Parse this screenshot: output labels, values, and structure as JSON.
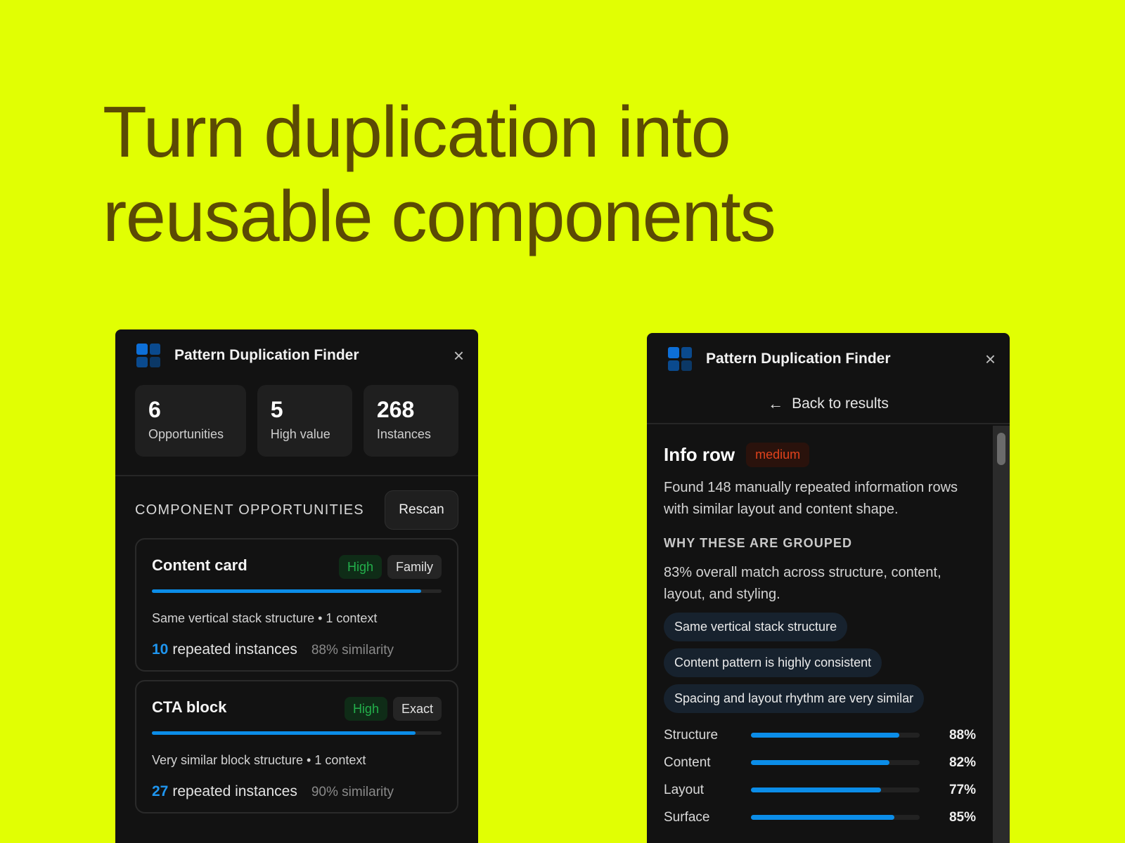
{
  "hero": {
    "line1": "Turn duplication into",
    "line2": "reusable components"
  },
  "left_panel": {
    "title": "Pattern Duplication Finder",
    "close": "×",
    "stats": [
      {
        "value": "6",
        "label": "Opportunities"
      },
      {
        "value": "5",
        "label": "High value"
      },
      {
        "value": "268",
        "label": "Instances"
      }
    ],
    "section_title": "COMPONENT OPPORTUNITIES",
    "rescan_label": "Rescan",
    "opportunities": [
      {
        "name": "Content card",
        "priority": "High",
        "kind": "Family",
        "progress": 0.93,
        "description": "Same vertical stack structure • 1 context",
        "count": "10",
        "count_suffix": "repeated instances",
        "similarity": "88% similarity"
      },
      {
        "name": "CTA block",
        "priority": "High",
        "kind": "Exact",
        "progress": 0.91,
        "description": "Very similar block structure • 1 context",
        "count": "27",
        "count_suffix": "repeated instances",
        "similarity": "90% similarity"
      }
    ]
  },
  "right_panel": {
    "title": "Pattern Duplication Finder",
    "close": "×",
    "back_icon": "arrow-left-icon",
    "back_label": "Back to results",
    "detail": {
      "title": "Info row",
      "badge": "medium",
      "description": "Found 148 manually repeated information rows with similar layout and content shape.",
      "why_title": "WHY THESE ARE GROUPED",
      "match_text": "83% overall match across structure, content, layout, and styling.",
      "reasons": [
        "Same vertical stack structure",
        "Content pattern is highly consistent",
        "Spacing and layout rhythm are very similar"
      ],
      "metrics": [
        {
          "label": "Structure",
          "value": "88%",
          "fill": 0.88
        },
        {
          "label": "Content",
          "value": "82%",
          "fill": 0.82
        },
        {
          "label": "Layout",
          "value": "77%",
          "fill": 0.77
        },
        {
          "label": "Surface",
          "value": "85%",
          "fill": 0.85
        }
      ]
    }
  },
  "colors": {
    "background": "#e1ff03",
    "hero_text": "#5b4a04",
    "panel": "#121212",
    "accent_blue": "#0b8de8",
    "high_green": "#23b04b",
    "medium_red": "#e0421c"
  }
}
